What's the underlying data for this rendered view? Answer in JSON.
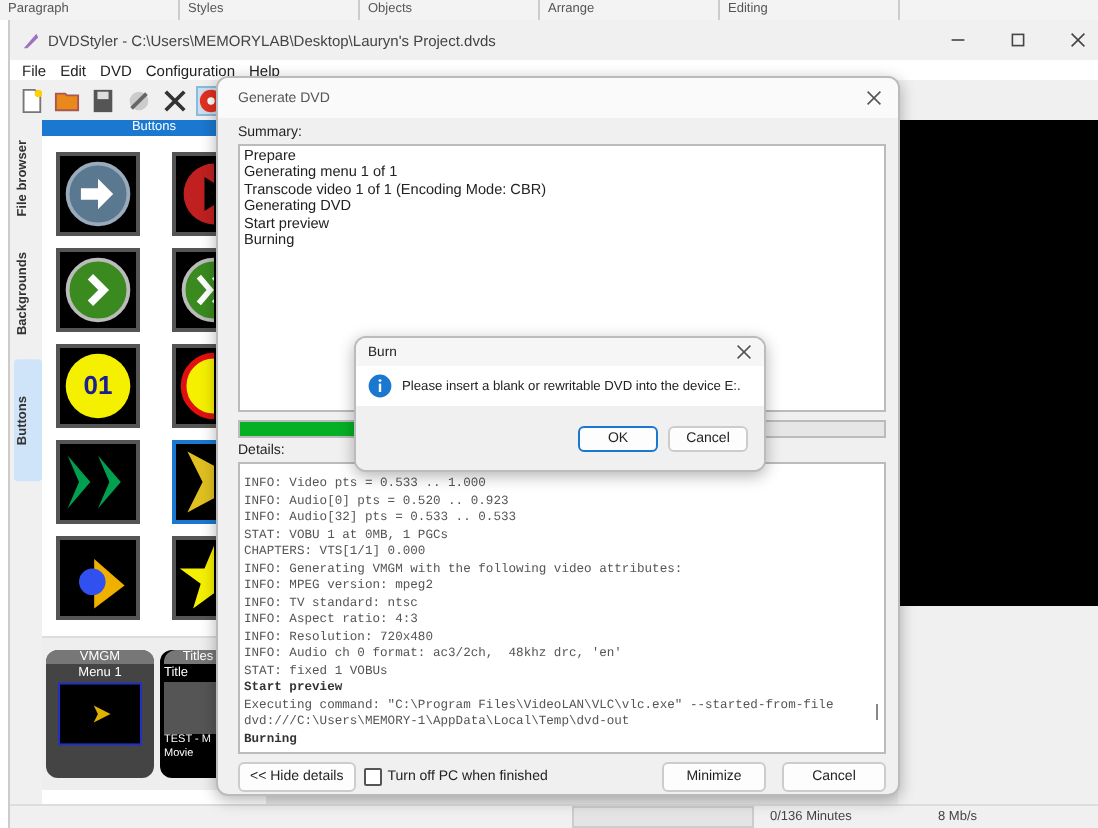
{
  "background_ribbon": [
    "Paragraph",
    "Styles",
    "Objects",
    "Arrange",
    "Editing"
  ],
  "window": {
    "title": "DVDStyler - C:\\Users\\MEMORYLAB\\Desktop\\Lauryn's Project.dvds"
  },
  "menu": [
    "File",
    "Edit",
    "DVD",
    "Configuration",
    "Help"
  ],
  "side_tabs": [
    {
      "label": "File browser",
      "selected": false
    },
    {
      "label": "Backgrounds",
      "selected": false
    },
    {
      "label": "Buttons",
      "selected": true
    }
  ],
  "button_panel": {
    "header": "Buttons",
    "items": [
      {
        "kind": "arrow-circle",
        "selected": false
      },
      {
        "kind": "play-circle",
        "selected": false
      },
      {
        "kind": "chevron-circle",
        "selected": false
      },
      {
        "kind": "double-chevron-circle",
        "selected": false
      },
      {
        "kind": "number-circle",
        "label": "01",
        "selected": false
      },
      {
        "kind": "ring-circle",
        "selected": false
      },
      {
        "kind": "double-chevron",
        "selected": false
      },
      {
        "kind": "pointed-arrow",
        "selected": true
      },
      {
        "kind": "ball-arrow",
        "selected": false
      },
      {
        "kind": "star",
        "selected": false
      }
    ]
  },
  "menus": [
    {
      "header": "VMGM",
      "caption": "Menu 1",
      "kind": "menu"
    },
    {
      "header": "Titles",
      "caption": "Title",
      "kind": "title",
      "footer": [
        "TEST - M",
        "Movie"
      ]
    }
  ],
  "status_bar": [
    "0/136 Minutes",
    "8 Mb/s"
  ],
  "generate_dialog": {
    "title": "Generate DVD",
    "summary_label": "Summary:",
    "summary": [
      "Prepare",
      "Generating menu 1 of 1",
      "Transcode video 1 of 1 (Encoding Mode: CBR)",
      "Generating DVD",
      "Start preview",
      "Burning"
    ],
    "progress": {
      "level": 0.4
    },
    "details_label": "Details:",
    "details": [
      {
        "text": "INFO: Video pts = 0.533 .. 1.000",
        "kind": "plain"
      },
      {
        "text": "INFO: Audio[0] pts = 0.520 .. 0.923",
        "kind": "plain"
      },
      {
        "text": "INFO: Audio[32] pts = 0.533 .. 0.533",
        "kind": "plain"
      },
      {
        "text": "STAT: VOBU 1 at 0MB, 1 PGCs",
        "kind": "plain"
      },
      {
        "text": "CHAPTERS: VTS[1/1] 0.000",
        "kind": "plain"
      },
      {
        "text": "INFO: Generating VMGM with the following video attributes:",
        "kind": "plain"
      },
      {
        "text": "INFO: MPEG version: mpeg2",
        "kind": "plain"
      },
      {
        "text": "INFO: TV standard: ntsc",
        "kind": "plain"
      },
      {
        "text": "INFO: Aspect ratio: 4:3",
        "kind": "plain"
      },
      {
        "text": "INFO: Resolution: 720x480",
        "kind": "plain"
      },
      {
        "text": "INFO: Audio ch 0 format: ac3/2ch,  48khz drc, 'en'",
        "kind": "plain"
      },
      {
        "text": "STAT: fixed 1 VOBUs",
        "kind": "plain"
      },
      {
        "text": "Start preview",
        "kind": "bold"
      },
      {
        "text": "Executing command: \"C:\\Program Files\\VideoLAN\\VLC\\vlc.exe\" --started-from-file",
        "kind": "plain"
      },
      {
        "text": "dvd:///C:\\Users\\MEMORY-1\\AppData\\Local\\Temp\\dvd-out",
        "kind": "plain"
      },
      {
        "text": "Burning",
        "kind": "bold"
      }
    ],
    "hide_details": "<< Hide details",
    "turn_off": {
      "label": "Turn off PC when finished",
      "checked": false
    },
    "buttons": [
      "Minimize",
      "Cancel"
    ]
  },
  "burn_dialog": {
    "title": "Burn",
    "message": "Please insert a blank or rewritable DVD into the device E:.",
    "buttons": [
      "OK",
      "Cancel"
    ]
  }
}
